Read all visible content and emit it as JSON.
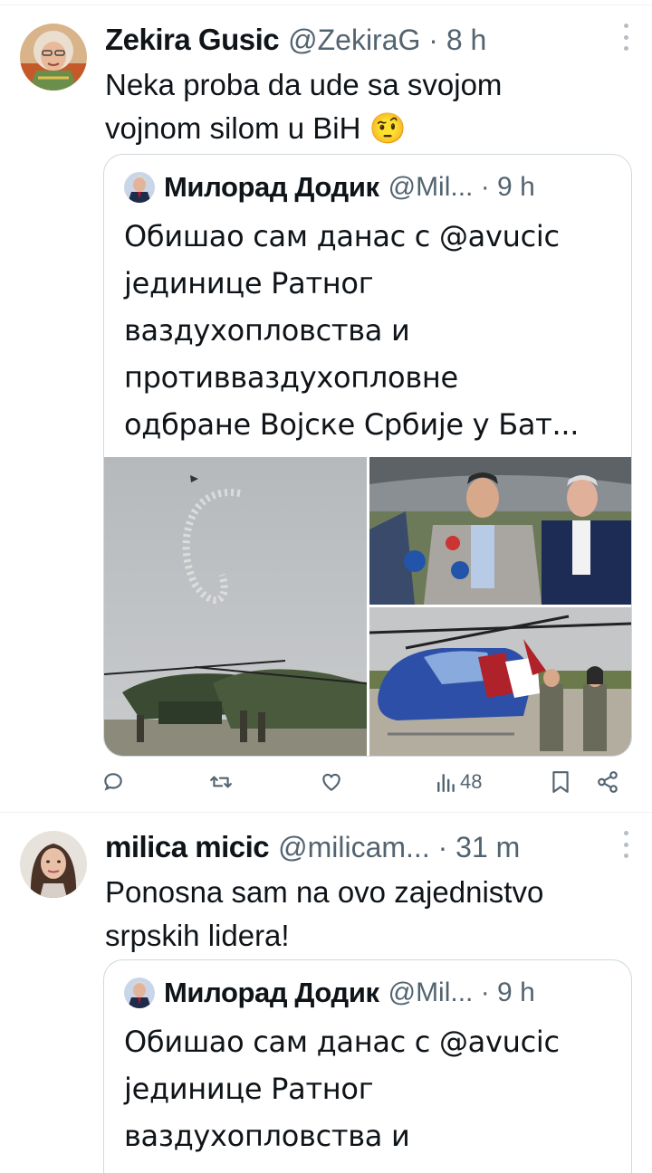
{
  "tweets": [
    {
      "author_name": "Zekira Gusic",
      "handle_time": "@ZekiraG · 8 h",
      "text": "Neka proba da ude sa svojom\nvojnom silom u BiH 🤨",
      "quote": {
        "author_name": "Милорад Додик",
        "handle_time": "@Mil... · 9 h",
        "text": "Обишао сам данас с @avucic\nјединице Ратног\nваздухопловства и\nпротивваздухопловне\nодбране Војске Србије у Бат..."
      },
      "actions": {
        "views": "48"
      }
    },
    {
      "author_name": "milica micic",
      "handle_time": "@milicam... · 31 m",
      "text": "Ponosna sam na ovo zajednistvo\nsrpskih lidera!",
      "quote": {
        "author_name": "Милорад Додик",
        "handle_time": "@Mil... · 9 h",
        "text": "Обишао сам данас с @avucic\nјединице Ратног\nваздухопловства и"
      }
    }
  ],
  "icons": {
    "reply": "reply-icon",
    "retweet": "retweet-icon",
    "like": "like-icon",
    "views": "views-icon",
    "bookmark": "bookmark-icon",
    "share": "share-icon",
    "more": "more-icon"
  },
  "colors": {
    "text": "#0f1419",
    "secondary": "#536471",
    "border": "#cfd9de",
    "divider": "#eff3f4"
  }
}
